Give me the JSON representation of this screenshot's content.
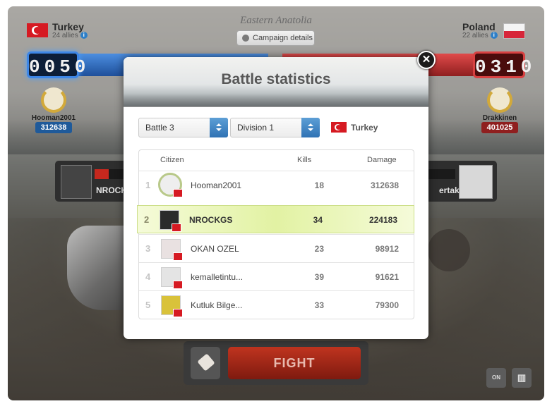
{
  "battle": {
    "region": "Eastern Anatolia",
    "campaign_details_label": "Campaign details",
    "left": {
      "country": "Turkey",
      "allies": "24 allies",
      "score": "0050",
      "hero_name": "Hooman2001",
      "hero_damage": "312638",
      "fighter_name": "NROCK"
    },
    "right": {
      "country": "Poland",
      "allies": "22 allies",
      "score": "0310",
      "hero_name": "Drakkinen",
      "hero_damage": "401025",
      "fighter_name": "ertaken"
    },
    "fight_label": "FIGHT",
    "on_label": "ON"
  },
  "modal": {
    "title": "Battle statistics",
    "close_symbol": "✕",
    "battle_select": "Battle 3",
    "division_select": "Division 1",
    "country": "Turkey",
    "columns": {
      "citizen": "Citizen",
      "kills": "Kills",
      "damage": "Damage"
    },
    "rows": [
      {
        "rank": "1",
        "name": "Hooman2001",
        "kills": "18",
        "damage": "312638",
        "highlighted": false
      },
      {
        "rank": "2",
        "name": "NROCKGS",
        "kills": "34",
        "damage": "224183",
        "highlighted": true
      },
      {
        "rank": "3",
        "name": "OKAN OZEL",
        "kills": "23",
        "damage": "98912",
        "highlighted": false
      },
      {
        "rank": "4",
        "name": "kemalletintu...",
        "kills": "39",
        "damage": "91621",
        "highlighted": false
      },
      {
        "rank": "5",
        "name": "Kutluk Bilge...",
        "kills": "33",
        "damage": "79300",
        "highlighted": false
      }
    ]
  },
  "colors": {
    "accent_blue": "#2f72b4",
    "turkey_red": "#d61a22",
    "highlight_green": "#e2f2a3",
    "fight_red": "#c0341f"
  },
  "icons": [
    "info-icon",
    "globe-icon",
    "close-icon",
    "chevron-up-down-icon",
    "laurel-icon",
    "weapon-icon",
    "stats-icon"
  ]
}
